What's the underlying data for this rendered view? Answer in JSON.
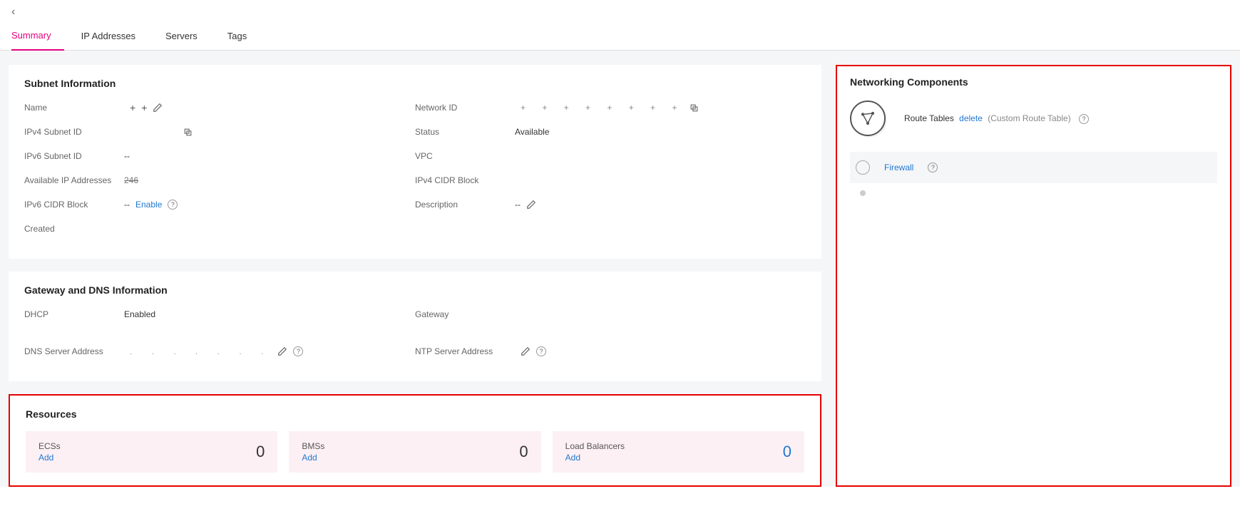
{
  "header": {
    "breadcrumb_placeholder": ""
  },
  "tabs": {
    "summary": "Summary",
    "ip": "IP Addresses",
    "servers": "Servers",
    "tags": "Tags"
  },
  "subnet": {
    "title": "Subnet Information",
    "labels": {
      "name": "Name",
      "ipv4_subnet_id": "IPv4 Subnet ID",
      "ipv6_subnet_id": "IPv6 Subnet ID",
      "available_ip": "Available IP Addresses",
      "ipv6_cidr": "IPv6 CIDR Block",
      "created": "Created",
      "network_id": "Network ID",
      "status": "Status",
      "vpc": "VPC",
      "ipv4_cidr": "IPv4 CIDR Block",
      "description": "Description"
    },
    "values": {
      "name": "",
      "ipv4_subnet_id": "",
      "ipv6_subnet_id": "--",
      "available_ip": "246",
      "ipv6_cidr_prefix": "--",
      "ipv6_enable": "Enable",
      "created": "",
      "network_id": "",
      "status": "Available",
      "vpc": "",
      "ipv4_cidr": "",
      "description": "--"
    }
  },
  "gateway": {
    "title": "Gateway and DNS Information",
    "labels": {
      "dhcp": "DHCP",
      "dns": "DNS Server Address",
      "gateway": "Gateway",
      "ntp": "NTP Server Address"
    },
    "values": {
      "dhcp": "Enabled",
      "dns": "",
      "gateway": "",
      "ntp": ""
    }
  },
  "resources": {
    "title": "Resources",
    "tiles": [
      {
        "name": "ECSs",
        "add": "Add",
        "count": "0"
      },
      {
        "name": "BMSs",
        "add": "Add",
        "count": "0"
      },
      {
        "name": "Load Balancers",
        "add": "Add",
        "count": "0"
      }
    ]
  },
  "networking": {
    "title": "Networking Components",
    "route_tables_label": "Route Tables",
    "route_tables_link": "delete",
    "route_tables_sub": "(Custom Route Table)",
    "firewall": "Firewall",
    "item2": ""
  }
}
